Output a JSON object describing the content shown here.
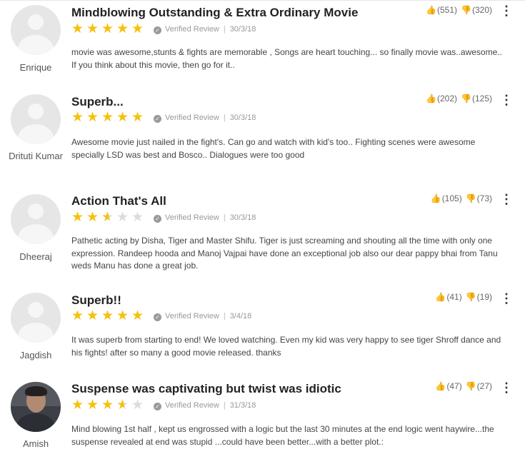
{
  "reviews": [
    {
      "name": "Enrique",
      "title": "Mindblowing Outstanding & Extra Ordinary Movie",
      "rating": 5,
      "verified": "Verified Review",
      "date": "30/3/18",
      "text": "movie was awesome,stunts & fights are memorable , Songs are heart touching... so finally movie was..awesome.. If you think about this movie, then go for it..",
      "up": "(551)",
      "down": "(320)"
    },
    {
      "name": "Drituti Kumar",
      "title": "Superb...",
      "rating": 5,
      "verified": "Verified Review",
      "date": "30/3/18",
      "text": "Awesome movie just nailed in the fight's. Can go and watch with kid's too.. Fighting scenes were awesome specially LSD was best and Bosco.. Dialogues were too good",
      "up": "(202)",
      "down": "(125)"
    },
    {
      "name": "Dheeraj",
      "title": "Action That's All",
      "rating": 2.5,
      "verified": "Verified Review",
      "date": "30/3/18",
      "text": "Pathetic acting by Disha, Tiger and Master Shifu. Tiger is just screaming and shouting all the time with only one expression. Randeep hooda and Manoj Vajpai have done an exceptional job also our dear pappy bhai from Tanu weds Manu has done a great job.",
      "up": "(105)",
      "down": "(73)"
    },
    {
      "name": "Jagdish",
      "title": "Superb!!",
      "rating": 5,
      "verified": "Verified Review",
      "date": "3/4/18",
      "text": "It was superb from starting to end! We loved watching. Even my kid was very happy to see tiger Shroff dance and his fights! after so many a good movie released. thanks",
      "up": "(41)",
      "down": "(19)"
    },
    {
      "name": "Amish",
      "title": "Suspense was captivating but twist was idiotic",
      "rating": 3.5,
      "verified": "Verified Review",
      "date": "31/3/18",
      "text": "Mind blowing 1st half , kept us engrossed with a logic but the last 30 minutes at the end logic went haywire...the suspense revealed at end was stupid ...could have been better...with a better plot.:",
      "up": "(47)",
      "down": "(27)"
    }
  ],
  "icons": {
    "thumbs_up": "thumbs-up-icon",
    "thumbs_down": "thumbs-down-icon",
    "more": "more-vertical-icon",
    "check": "check-circle-icon"
  },
  "colors": {
    "star": "#f4c20d",
    "star_empty": "#dcdcdc",
    "thumbs_up": "#2e9e2e",
    "thumbs_down": "#d9242a"
  }
}
